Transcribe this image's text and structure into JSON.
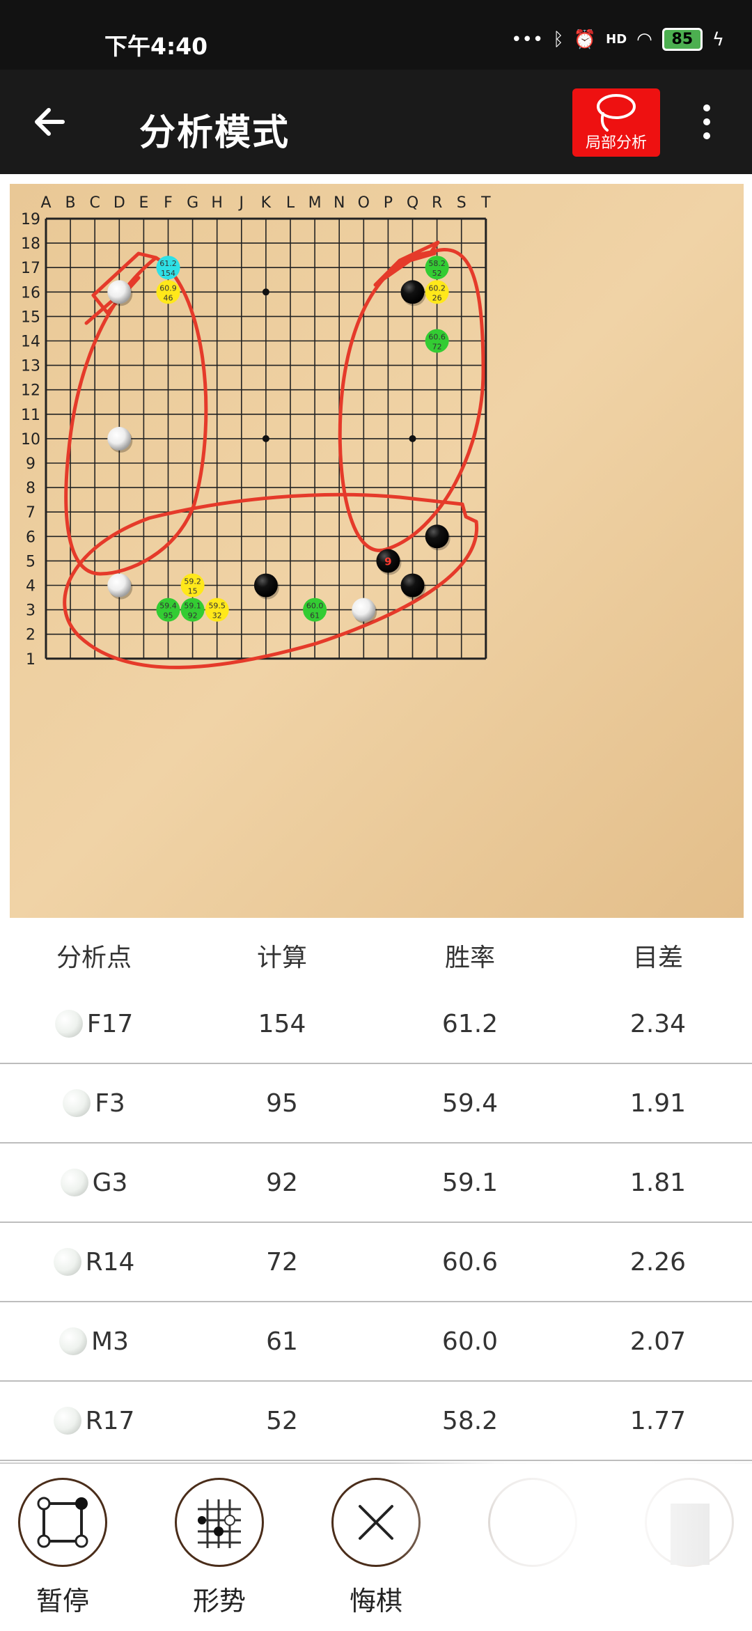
{
  "status": {
    "time": "下午4:40",
    "battery": "85",
    "network": "HD"
  },
  "appbar": {
    "title": "分析模式",
    "local_analysis_label": "局部分析"
  },
  "board": {
    "columns": [
      "A",
      "B",
      "C",
      "D",
      "E",
      "F",
      "G",
      "H",
      "J",
      "K",
      "L",
      "M",
      "N",
      "O",
      "P",
      "Q",
      "R",
      "S",
      "T"
    ],
    "rows": [
      "19",
      "18",
      "17",
      "16",
      "15",
      "14",
      "13",
      "12",
      "11",
      "10",
      "9",
      "8",
      "7",
      "6",
      "5",
      "4",
      "3",
      "2",
      "1"
    ],
    "stones": [
      {
        "color": "white",
        "pos": "D16"
      },
      {
        "color": "white",
        "pos": "D10"
      },
      {
        "color": "black",
        "pos": "Q16"
      },
      {
        "color": "black",
        "pos": "R6"
      },
      {
        "color": "black",
        "pos": "P5",
        "label": "9"
      },
      {
        "color": "black",
        "pos": "Q4"
      },
      {
        "color": "black",
        "pos": "K4"
      },
      {
        "color": "white",
        "pos": "D4"
      },
      {
        "color": "white",
        "pos": "O3"
      }
    ],
    "candidates": [
      {
        "pos": "F17",
        "winrate": "61.2",
        "visits": "154",
        "color": "#2ee0e6"
      },
      {
        "pos": "F16",
        "winrate": "60.9",
        "visits": "46",
        "color": "#ffe81a"
      },
      {
        "pos": "R17",
        "winrate": "58.2",
        "visits": "52",
        "color": "#33cc33"
      },
      {
        "pos": "R16",
        "winrate": "60.2",
        "visits": "26",
        "color": "#ffe81a"
      },
      {
        "pos": "R14",
        "winrate": "60.6",
        "visits": "72",
        "color": "#33cc33"
      },
      {
        "pos": "G4",
        "winrate": "59.2",
        "visits": "15",
        "color": "#ffe81a"
      },
      {
        "pos": "F3",
        "winrate": "59.4",
        "visits": "95",
        "color": "#33cc33"
      },
      {
        "pos": "G3",
        "winrate": "59.1",
        "visits": "92",
        "color": "#33cc33"
      },
      {
        "pos": "H3",
        "winrate": "59.5",
        "visits": "32",
        "color": "#ffe81a"
      },
      {
        "pos": "M3",
        "winrate": "60.0",
        "visits": "61",
        "color": "#33cc33"
      }
    ]
  },
  "table": {
    "headers": {
      "point": "分析点",
      "visits": "计算",
      "winrate": "胜率",
      "score": "目差"
    },
    "rows": [
      {
        "point": "F17",
        "visits": "154",
        "winrate": "61.2",
        "score": "2.34"
      },
      {
        "point": "F3",
        "visits": "95",
        "winrate": "59.4",
        "score": "1.91"
      },
      {
        "point": "G3",
        "visits": "92",
        "winrate": "59.1",
        "score": "1.81"
      },
      {
        "point": "R14",
        "visits": "72",
        "winrate": "60.6",
        "score": "2.26"
      },
      {
        "point": "M3",
        "visits": "61",
        "winrate": "60.0",
        "score": "2.07"
      },
      {
        "point": "R17",
        "visits": "52",
        "winrate": "58.2",
        "score": "1.77"
      }
    ]
  },
  "toolbar": {
    "pause_label": "暂停",
    "situation_label": "形势",
    "undo_label": "悔棋"
  }
}
